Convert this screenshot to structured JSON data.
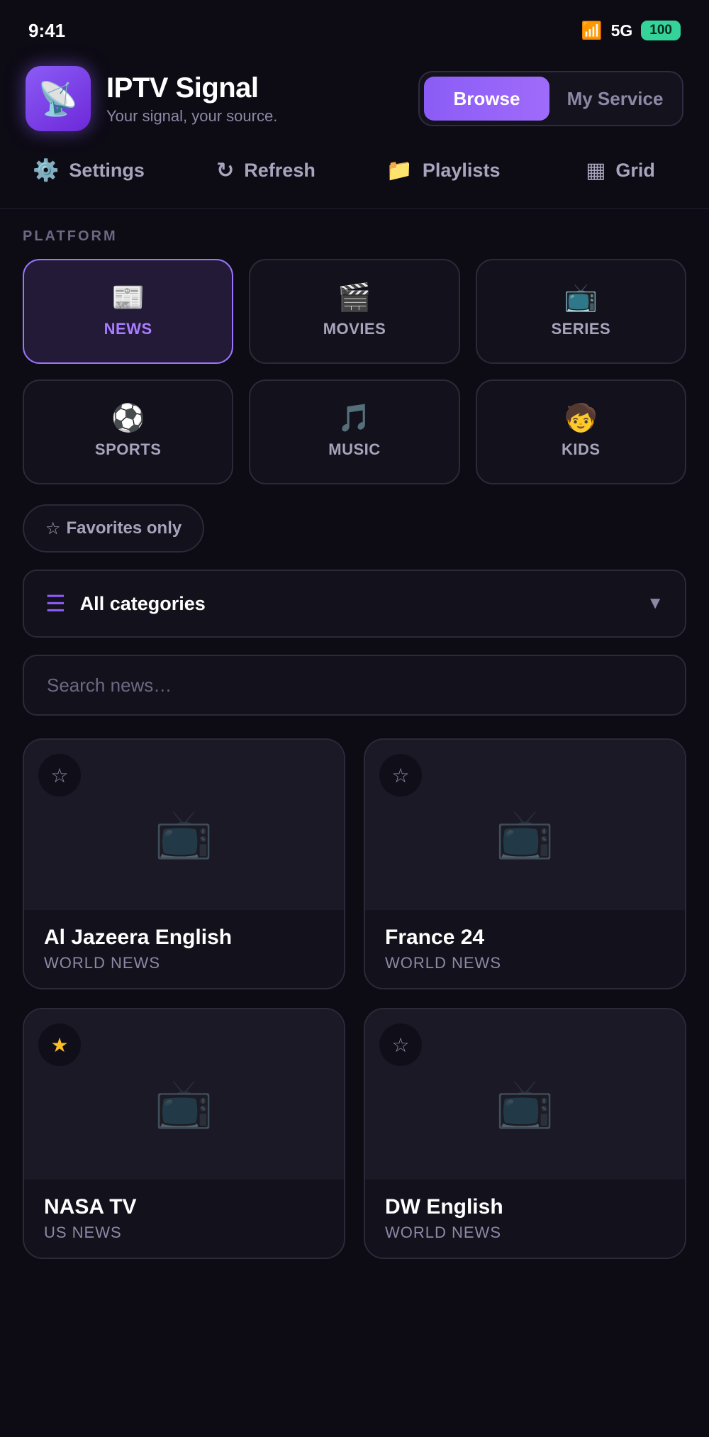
{
  "status_bar": {
    "time": "9:41",
    "network": "5G",
    "battery": "100",
    "signal_icon": "signal-bars-icon"
  },
  "app": {
    "title": "IPTV Signal",
    "subtitle": "Your signal, your source.",
    "logo_icon": "satellite-dish-icon"
  },
  "mode_tabs": [
    {
      "label": "Browse",
      "active": true
    },
    {
      "label": "My Service",
      "active": false
    }
  ],
  "toolbar": [
    {
      "label": "Settings",
      "icon": "gear-icon"
    },
    {
      "label": "Refresh",
      "icon": "refresh-icon"
    },
    {
      "label": "Playlists",
      "icon": "folder-icon"
    },
    {
      "label": "Grid",
      "icon": "grid-icon"
    }
  ],
  "platform": {
    "section_label": "PLATFORM",
    "items": [
      {
        "label": "NEWS",
        "icon": "newspaper-icon",
        "active": true
      },
      {
        "label": "MOVIES",
        "icon": "clapperboard-icon",
        "active": false
      },
      {
        "label": "SERIES",
        "icon": "television-icon",
        "active": false
      },
      {
        "label": "SPORTS",
        "icon": "soccer-ball-icon",
        "active": false
      },
      {
        "label": "MUSIC",
        "icon": "music-note-icon",
        "active": false
      },
      {
        "label": "KIDS",
        "icon": "child-icon",
        "active": false
      }
    ]
  },
  "filters": {
    "favorites_label": "Favorites only",
    "category_label": "All categories",
    "search_placeholder": "Search news…",
    "search_value": ""
  },
  "channels": [
    {
      "name": "Al Jazeera English",
      "category": "WORLD NEWS",
      "favorite": false
    },
    {
      "name": "France 24",
      "category": "WORLD NEWS",
      "favorite": false
    },
    {
      "name": "NASA TV",
      "category": "US NEWS",
      "favorite": true
    },
    {
      "name": "DW English",
      "category": "WORLD NEWS",
      "favorite": false
    }
  ],
  "colors": {
    "accent": "#8b5cf6",
    "background": "#0d0b14",
    "favorite": "#fbbf24",
    "battery": "#34d399"
  }
}
